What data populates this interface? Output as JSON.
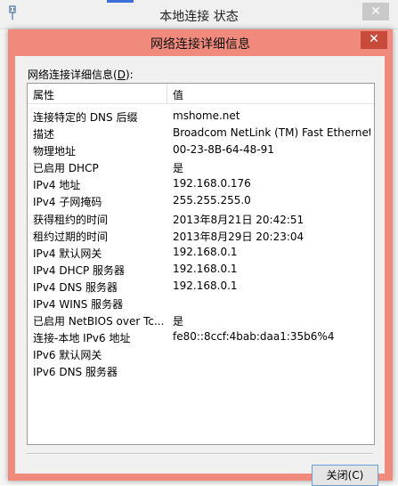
{
  "parent_window": {
    "title": "本地连接 状态",
    "close_glyph": "✕"
  },
  "dialog": {
    "title": "网络连接详细信息",
    "close_glyph": "✕",
    "details_label": "网络连接详细信息(",
    "details_label_key": "D",
    "details_label_suffix": "):",
    "columns": [
      "属性",
      "值"
    ],
    "rows": [
      [
        "连接特定的 DNS 后缀",
        "mshome.net"
      ],
      [
        "描述",
        "Broadcom NetLink (TM) Fast Ethernet"
      ],
      [
        "物理地址",
        "00-23-8B-64-48-91"
      ],
      [
        "已启用 DHCP",
        "是"
      ],
      [
        "IPv4 地址",
        "192.168.0.176"
      ],
      [
        "IPv4 子网掩码",
        "255.255.255.0"
      ],
      [
        "获得租约的时间",
        "2013年8月21日 20:42:51"
      ],
      [
        "租约过期的时间",
        "2013年8月29日 20:23:04"
      ],
      [
        "IPv4 默认网关",
        "192.168.0.1"
      ],
      [
        "IPv4 DHCP 服务器",
        "192.168.0.1"
      ],
      [
        "IPv4 DNS 服务器",
        "192.168.0.1"
      ],
      [
        "IPv4 WINS 服务器",
        ""
      ],
      [
        "已启用 NetBIOS over Tc...",
        "是"
      ],
      [
        "连接-本地 IPv6 地址",
        "fe80::8ccf:4bab:daa1:35b6%4"
      ],
      [
        "IPv6 默认网关",
        ""
      ],
      [
        "IPv6 DNS 服务器",
        ""
      ]
    ],
    "close_button_label": "关闭(C)"
  },
  "colors": {
    "dialog_frame": "#f08a7c",
    "dialog_close": "#c74a3a",
    "button_border": "#6a9fd4"
  }
}
